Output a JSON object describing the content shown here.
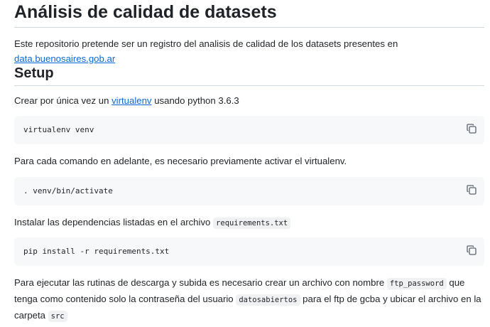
{
  "readme": {
    "title": "Análisis de calidad de datasets",
    "intro": {
      "text": "Este repositorio pretende ser un registro del analisis de calidad de los datasets presentes en ",
      "link": "data.buenosaires.gob.ar"
    },
    "setup": {
      "heading": "Setup",
      "step1": {
        "before": "Crear por única vez un ",
        "link": "virtualenv",
        "after": " usando python 3.6.3"
      },
      "code1": "virtualenv venv",
      "step2": "Para cada comando en adelante, es necesario previamente activar el virtualenv.",
      "code2": ". venv/bin/activate",
      "step3": {
        "before": "Instalar las dependencias listadas en el archivo ",
        "code": "requirements.txt"
      },
      "code3": "pip install -r requirements.txt",
      "step4": {
        "part1": "Para ejecutar las rutinas de descarga y subida es necesario crear un archivo con nombre ",
        "code1": "ftp_password",
        "part2": " que tenga como contenido solo la contraseña del usuario ",
        "code2": "datosabiertos",
        "part3": " para el ftp de gcba y ubicar el archivo en la carpeta ",
        "code3": "src"
      }
    },
    "icons": {
      "copy": "copy-icon"
    }
  }
}
